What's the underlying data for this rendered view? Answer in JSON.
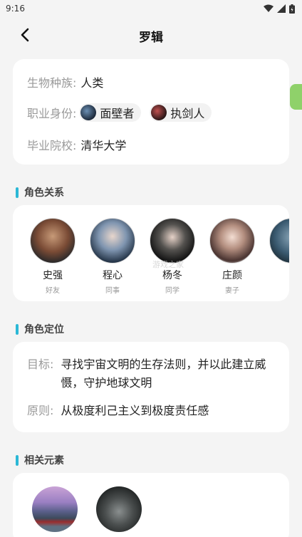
{
  "status_bar": {
    "time": "9:16"
  },
  "header": {
    "title": "罗辑"
  },
  "info": {
    "species_label": "生物种族:",
    "species_value": "人类",
    "identity_label": "职业身份:",
    "identity_tags": [
      "面壁者",
      "执剑人"
    ],
    "school_label": "毕业院校:",
    "school_value": "清华大学"
  },
  "relations": {
    "heading": "角色关系",
    "items": [
      {
        "name": "史强",
        "role": "好友"
      },
      {
        "name": "程心",
        "role": "同事"
      },
      {
        "name": "杨冬",
        "role": "同学"
      },
      {
        "name": "庄颜",
        "role": "妻子"
      }
    ]
  },
  "positioning": {
    "heading": "角色定位",
    "goal_label": "目标:",
    "goal_text": "寻找宇宙文明的生存法则，并以此建立威慑，守护地球文明",
    "principle_label": "原则:",
    "principle_text": "从极度利己主义到极度责任感"
  },
  "elements": {
    "heading": "相关元素"
  },
  "watermark": {
    "logo": "K73",
    "sub": "游戏之家"
  },
  "colors": {
    "accent": "#2bb8d6",
    "background": "#f4f4f4"
  }
}
